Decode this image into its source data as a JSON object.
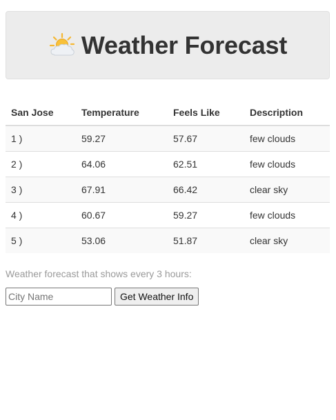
{
  "header": {
    "icon": "sun-behind-cloud-icon",
    "title": "Weather Forecast"
  },
  "table": {
    "headers": [
      "San Jose",
      "Temperature",
      "Feels Like",
      "Description"
    ],
    "rows": [
      {
        "index": "1 )",
        "temperature": "59.27",
        "feels_like": "57.67",
        "description": "few clouds"
      },
      {
        "index": "2 )",
        "temperature": "64.06",
        "feels_like": "62.51",
        "description": "few clouds"
      },
      {
        "index": "3 )",
        "temperature": "67.91",
        "feels_like": "66.42",
        "description": "clear sky"
      },
      {
        "index": "4 )",
        "temperature": "60.67",
        "feels_like": "59.27",
        "description": "few clouds"
      },
      {
        "index": "5 )",
        "temperature": "53.06",
        "feels_like": "51.87",
        "description": "clear sky"
      }
    ]
  },
  "note": "Weather forecast that shows every 3 hours:",
  "form": {
    "city_input_value": "",
    "city_input_placeholder": "City Name",
    "submit_label": "Get Weather Info"
  },
  "colors": {
    "header_bg": "#ececec",
    "text": "#333333",
    "muted_text": "#9a9a9a",
    "row_stripe": "#f9f9f9",
    "sun": "#f5b731",
    "cloud": "#e9edf2"
  }
}
